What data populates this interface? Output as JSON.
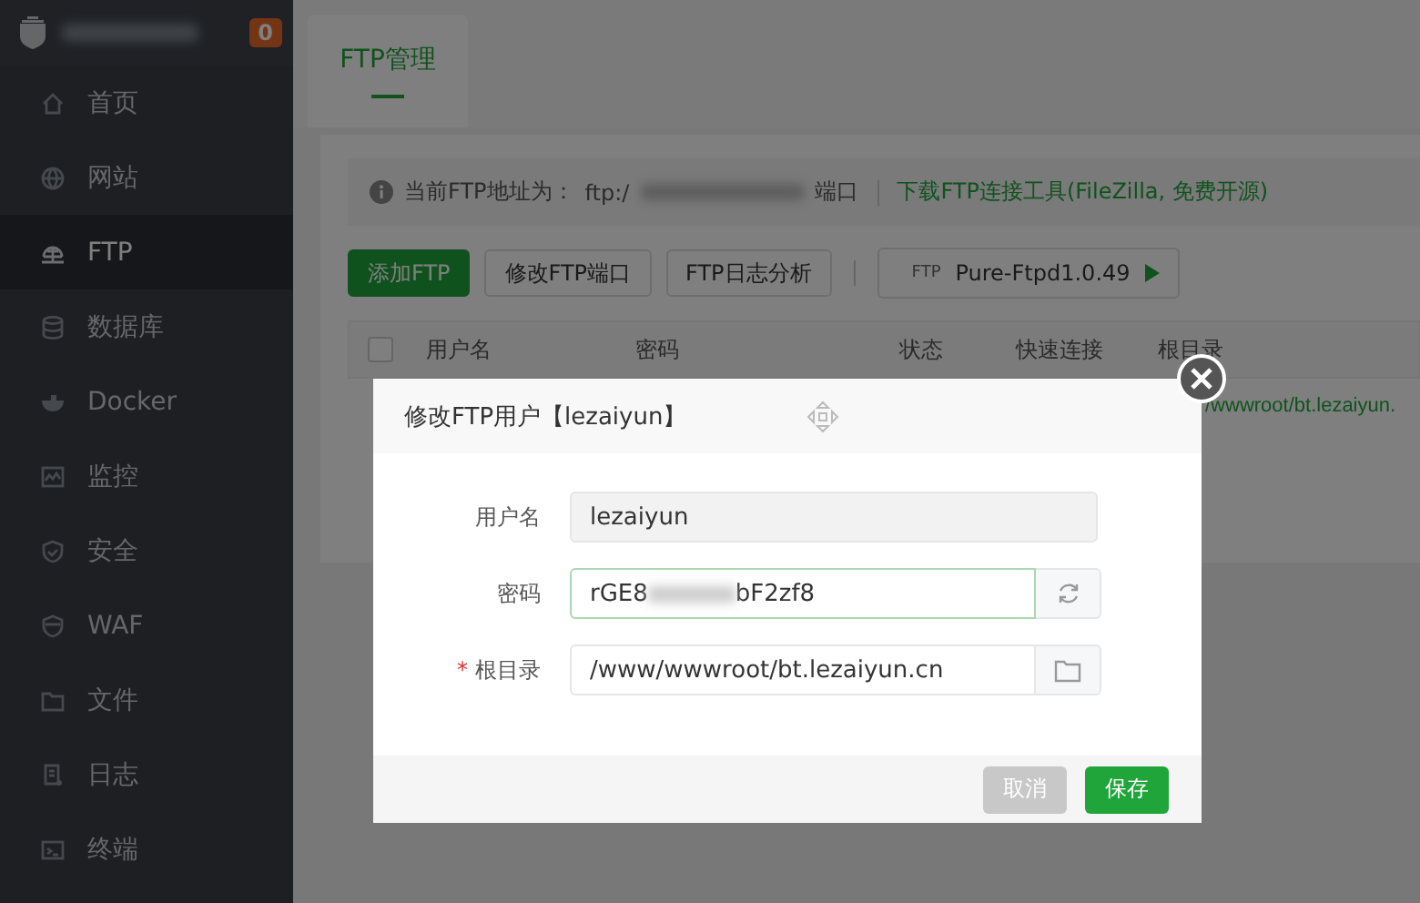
{
  "sidebar": {
    "badge": "0",
    "items": [
      {
        "label": "首页",
        "selected": false
      },
      {
        "label": "网站",
        "selected": false
      },
      {
        "label": "FTP",
        "selected": true
      },
      {
        "label": "数据库",
        "selected": false
      },
      {
        "label": "Docker",
        "selected": false
      },
      {
        "label": "监控",
        "selected": false
      },
      {
        "label": "安全",
        "selected": false
      },
      {
        "label": "WAF",
        "selected": false
      },
      {
        "label": "文件",
        "selected": false
      },
      {
        "label": "日志",
        "selected": false
      },
      {
        "label": "终端",
        "selected": false
      }
    ]
  },
  "tabs": [
    {
      "label": "FTP管理",
      "selected": true
    }
  ],
  "info_bar": {
    "text": "当前FTP地址为：",
    "scheme": "ftp:/",
    "port_label": "端口",
    "link": "下载FTP连接工具(FileZilla, 免费开源)"
  },
  "toolbar": {
    "buttons": [
      {
        "label": "添加FTP",
        "kind": "primary"
      },
      {
        "label": "修改FTP端口",
        "kind": "default"
      },
      {
        "label": "FTP日志分析",
        "kind": "default"
      }
    ],
    "server": {
      "badge": "FTP",
      "name": "Pure-Ftpd1.0.49"
    }
  },
  "table": {
    "select_all": {
      "checked": false
    },
    "columns": [
      "用户名",
      "密码",
      "状态",
      "快速连接",
      "根目录"
    ],
    "rows": [
      {
        "root": "/wwwroot/bt.lezaiyun."
      }
    ]
  },
  "dialog": {
    "title": "修改FTP用户【lezaiyun】",
    "required_mark": "*",
    "fields": [
      {
        "label": "用户名",
        "value": "lezaiyun",
        "kind": "readonly",
        "required": false
      },
      {
        "label": "密码",
        "value_start": "rGE8",
        "value_end": "bF2zf8",
        "kind": "password",
        "required": false
      },
      {
        "label": "根目录",
        "value": "/www/wwwroot/bt.lezaiyun.cn",
        "kind": "folder",
        "required": true
      }
    ],
    "buttons": [
      {
        "label": "取消",
        "kind": "cancel"
      },
      {
        "label": "保存",
        "kind": "primary"
      }
    ]
  }
}
